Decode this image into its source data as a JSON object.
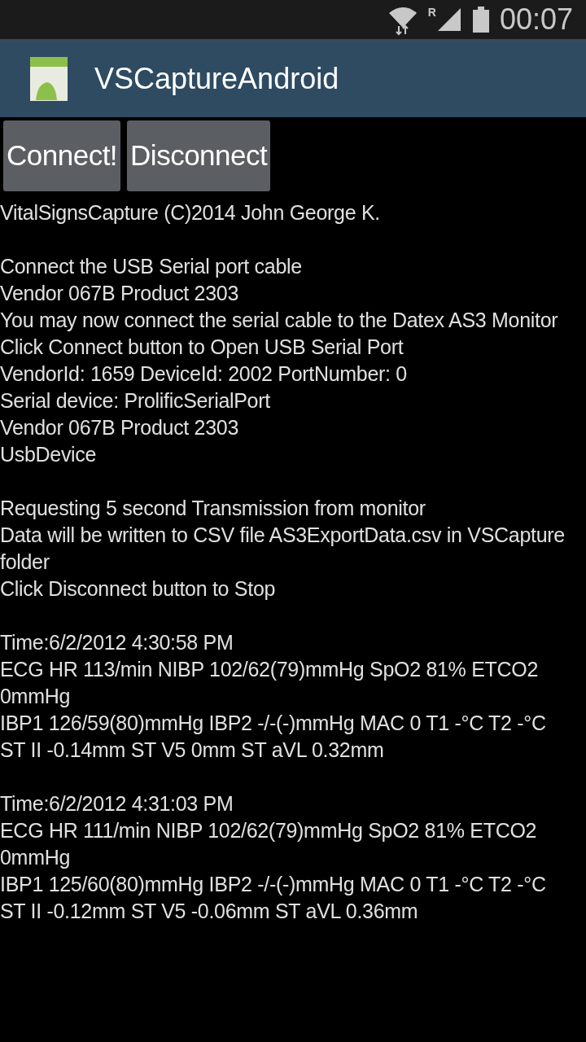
{
  "status_bar": {
    "time": "00:07",
    "roaming_mark": "R"
  },
  "action_bar": {
    "title": "VSCaptureAndroid"
  },
  "buttons": [
    "Connect!",
    "Disconnect"
  ],
  "log": [
    {
      "lines": [
        "VitalSignsCapture (C)2014 John George K."
      ]
    },
    {
      "lines": [
        "Connect the USB Serial port cable",
        "Vendor 067B Product 2303",
        "You may now connect the serial cable to the Datex AS3 Monitor",
        "Click Connect button to Open USB Serial Port",
        "VendorId: 1659 DeviceId: 2002 PortNumber: 0",
        "Serial device: ProlificSerialPort",
        "Vendor 067B Product 2303",
        "UsbDevice"
      ]
    },
    {
      "lines": [
        "Requesting 5 second Transmission from monitor",
        "Data will be written to CSV file AS3ExportData.csv in VSCapture folder",
        "Click Disconnect button to Stop"
      ]
    },
    {
      "lines": [
        "Time:6/2/2012 4:30:58 PM",
        "ECG HR 113/min NIBP 102/62(79)mmHg SpO2 81% ETCO2 0mmHg",
        "IBP1 126/59(80)mmHg IBP2 -/-(-)mmHg MAC 0 T1 -°C T2 -°C",
        "ST II -0.14mm ST V5 0mm ST aVL 0.32mm"
      ]
    },
    {
      "lines": [
        "Time:6/2/2012 4:31:03 PM",
        "ECG HR 111/min NIBP 102/62(79)mmHg SpO2 81% ETCO2 0mmHg",
        "IBP1 125/60(80)mmHg IBP2 -/-(-)mmHg MAC 0 T1 -°C T2 -°C",
        "ST II -0.12mm ST V5 -0.06mm ST aVL 0.36mm"
      ]
    }
  ]
}
